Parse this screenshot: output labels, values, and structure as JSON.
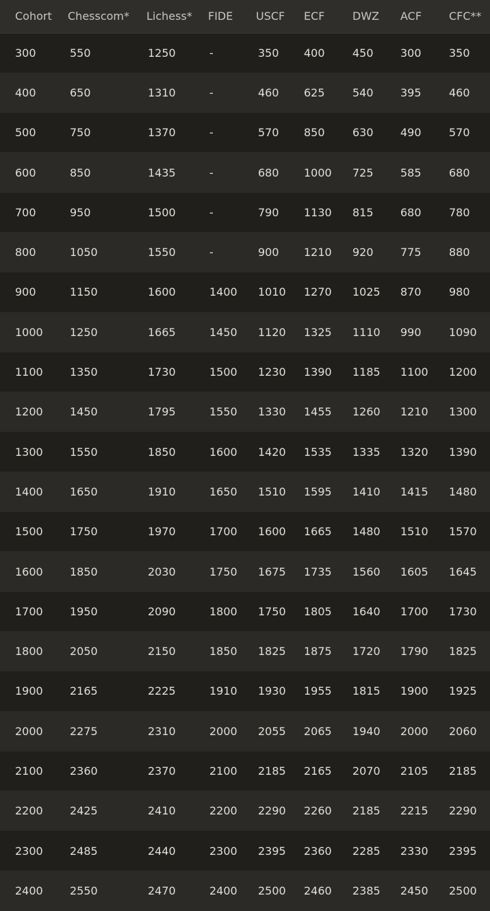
{
  "table": {
    "headers": [
      "Cohort",
      "Chesscom*",
      "Lichess*",
      "FIDE",
      "USCF",
      "ECF",
      "DWZ",
      "ACF",
      "CFC**"
    ],
    "rows": [
      [
        "300",
        "550",
        "1250",
        "-",
        "350",
        "400",
        "450",
        "300",
        "350"
      ],
      [
        "400",
        "650",
        "1310",
        "-",
        "460",
        "625",
        "540",
        "395",
        "460"
      ],
      [
        "500",
        "750",
        "1370",
        "-",
        "570",
        "850",
        "630",
        "490",
        "570"
      ],
      [
        "600",
        "850",
        "1435",
        "-",
        "680",
        "1000",
        "725",
        "585",
        "680"
      ],
      [
        "700",
        "950",
        "1500",
        "-",
        "790",
        "1130",
        "815",
        "680",
        "780"
      ],
      [
        "800",
        "1050",
        "1550",
        "-",
        "900",
        "1210",
        "920",
        "775",
        "880"
      ],
      [
        "900",
        "1150",
        "1600",
        "1400",
        "1010",
        "1270",
        "1025",
        "870",
        "980"
      ],
      [
        "1000",
        "1250",
        "1665",
        "1450",
        "1120",
        "1325",
        "1110",
        "990",
        "1090"
      ],
      [
        "1100",
        "1350",
        "1730",
        "1500",
        "1230",
        "1390",
        "1185",
        "1100",
        "1200"
      ],
      [
        "1200",
        "1450",
        "1795",
        "1550",
        "1330",
        "1455",
        "1260",
        "1210",
        "1300"
      ],
      [
        "1300",
        "1550",
        "1850",
        "1600",
        "1420",
        "1535",
        "1335",
        "1320",
        "1390"
      ],
      [
        "1400",
        "1650",
        "1910",
        "1650",
        "1510",
        "1595",
        "1410",
        "1415",
        "1480"
      ],
      [
        "1500",
        "1750",
        "1970",
        "1700",
        "1600",
        "1665",
        "1480",
        "1510",
        "1570"
      ],
      [
        "1600",
        "1850",
        "2030",
        "1750",
        "1675",
        "1735",
        "1560",
        "1605",
        "1645"
      ],
      [
        "1700",
        "1950",
        "2090",
        "1800",
        "1750",
        "1805",
        "1640",
        "1700",
        "1730"
      ],
      [
        "1800",
        "2050",
        "2150",
        "1850",
        "1825",
        "1875",
        "1720",
        "1790",
        "1825"
      ],
      [
        "1900",
        "2165",
        "2225",
        "1910",
        "1930",
        "1955",
        "1815",
        "1900",
        "1925"
      ],
      [
        "2000",
        "2275",
        "2310",
        "2000",
        "2055",
        "2065",
        "1940",
        "2000",
        "2060"
      ],
      [
        "2100",
        "2360",
        "2370",
        "2100",
        "2185",
        "2165",
        "2070",
        "2105",
        "2185"
      ],
      [
        "2200",
        "2425",
        "2410",
        "2200",
        "2290",
        "2260",
        "2185",
        "2215",
        "2290"
      ],
      [
        "2300",
        "2485",
        "2440",
        "2300",
        "2395",
        "2360",
        "2285",
        "2330",
        "2395"
      ],
      [
        "2400",
        "2550",
        "2470",
        "2400",
        "2500",
        "2460",
        "2385",
        "2450",
        "2500"
      ]
    ]
  }
}
